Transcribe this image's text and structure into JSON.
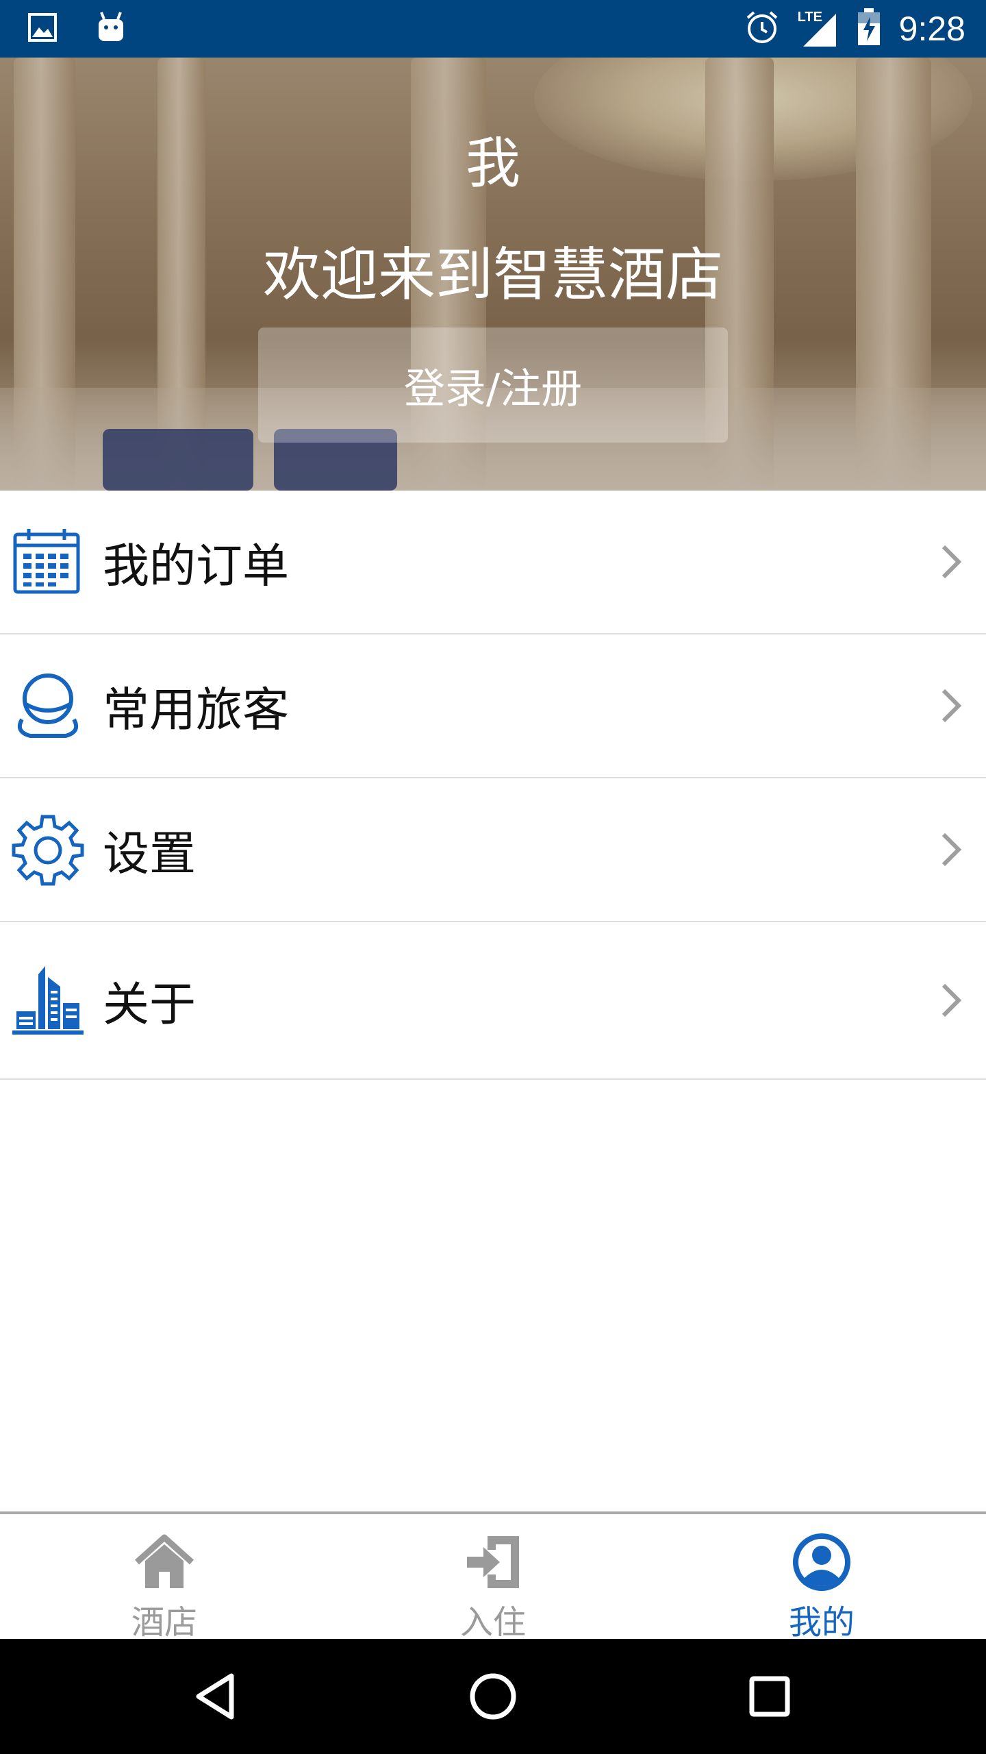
{
  "status_bar": {
    "time": "9:28",
    "network": "LTE",
    "left_icons": [
      "image-notification-icon",
      "android-notification-icon"
    ],
    "right_icons": [
      "alarm-icon",
      "lte-signal-icon",
      "battery-charging-icon"
    ]
  },
  "hero": {
    "title": "我",
    "welcome": "欢迎来到智慧酒店",
    "login_button": "登录/注册"
  },
  "menu": {
    "items": [
      {
        "label": "我的订单",
        "icon": "calendar-icon"
      },
      {
        "label": "常用旅客",
        "icon": "user-icon"
      },
      {
        "label": "设置",
        "icon": "gear-icon"
      },
      {
        "label": "关于",
        "icon": "building-icon"
      }
    ]
  },
  "tabbar": {
    "tabs": [
      {
        "label": "酒店",
        "icon": "home-icon",
        "active": false
      },
      {
        "label": "入住",
        "icon": "checkin-icon",
        "active": false
      },
      {
        "label": "我的",
        "icon": "profile-icon",
        "active": true
      }
    ]
  },
  "colors": {
    "status_bar": "#00457f",
    "accent": "#1565c0",
    "inactive_tab": "#9a9a9a",
    "chevron": "#9e9e9e"
  }
}
